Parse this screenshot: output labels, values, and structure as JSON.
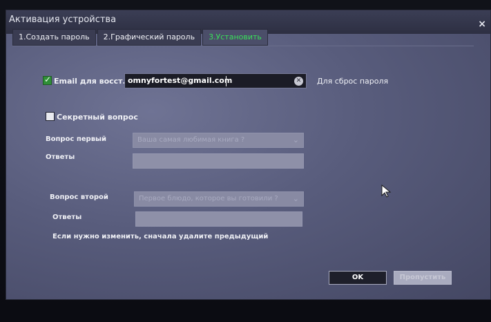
{
  "dialog": {
    "title": "Активация устройства",
    "close": "×"
  },
  "tabs": [
    {
      "label": "1.Создать пароль",
      "active": false
    },
    {
      "label": "2.Графический пароль",
      "active": false
    },
    {
      "label": "3.Установить",
      "active": true
    }
  ],
  "email": {
    "checkbox_checked": true,
    "label": "Email для восст...",
    "value": "omnyfortest@gmail.com",
    "hint": "Для сброс пароля"
  },
  "secret": {
    "checkbox_checked": false,
    "label": "Секретный вопрос"
  },
  "q1": {
    "label": "Вопрос первый",
    "placeholder": "Ваша самая любимая книга ?",
    "answer_label": "Ответы"
  },
  "q2": {
    "label": "Вопрос второй",
    "placeholder": "Первое блюдо, которое вы готовили ?",
    "answer_label": "Ответы"
  },
  "note": "Если нужно изменить, сначала удалите предыдущий",
  "buttons": {
    "ok": "OK",
    "cancel": "Пропустить"
  },
  "icons": {
    "clear": "clear-icon",
    "close": "close-icon",
    "chevron": "chevron-down-icon",
    "cursor": "mouse-pointer-icon"
  }
}
